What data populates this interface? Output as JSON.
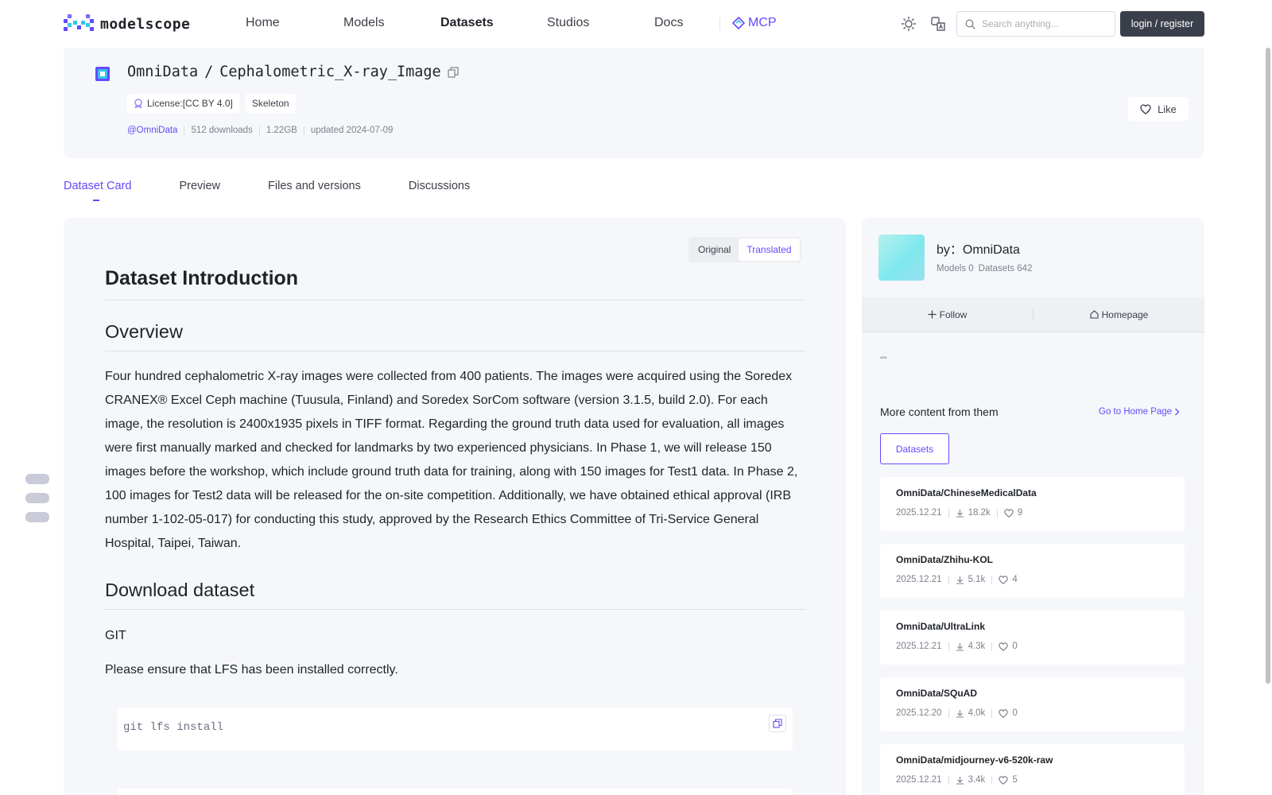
{
  "nav": {
    "logo_text": "modelscope",
    "links": [
      "Home",
      "Models",
      "Datasets",
      "Studios",
      "Docs"
    ],
    "mcp_label": "MCP",
    "search_placeholder": "Search anything...",
    "login_label": "login / register",
    "accent": "#624aff"
  },
  "dataset": {
    "owner": "OmniData",
    "separator": "/",
    "name": "Cephalometric_X-ray_Image",
    "tags": [
      "License:[CC BY 4.0]",
      "Skeleton"
    ],
    "owner_handle": "@OmniData",
    "downloads": "512 downloads",
    "size": "1.22GB",
    "updated": "updated 2024-07-09",
    "like_label": "Like"
  },
  "tabs": [
    "Dataset Card",
    "Preview",
    "Files and versions",
    "Discussions"
  ],
  "content": {
    "toggle_original": "Original",
    "toggle_translated": "Translated",
    "h1": "Dataset Introduction",
    "h2_overview": "Overview",
    "overview_text": "Four hundred cephalometric X-ray images were collected from 400 patients. The images were acquired using the Soredex CRANEX® Excel Ceph machine (Tuusula, Finland) and Soredex SorCom software (version 3.1.5, build 2.0). For each image, the resolution is 2400x1935 pixels in TIFF format. Regarding the ground truth data used for evaluation, all images were first manually marked and checked for landmarks by two experienced physicians. In Phase 1, we will release 150 images before the workshop, which include ground truth data for training, along with 150 images for Test1 data. In Phase 2, 100 images for Test2 data will be released for the on-site competition. Additionally, we have obtained ethical approval (IRB number 1-102-05-017) for conducting this study, approved by the Research Ethics Committee of Tri-Service General Hospital, Taipei, Taiwan.",
    "h2_download": "Download dataset",
    "git_label": "GIT",
    "lfs_note": "Please ensure that LFS has been installed correctly.",
    "code_line": "git lfs install"
  },
  "sidebar": {
    "by_prefix": "by：",
    "author": "OmniData",
    "models_count": "Models 0",
    "datasets_count": "Datasets 642",
    "follow_label": "Follow",
    "homepage_label": "Homepage",
    "quote": "\"\"",
    "more_title": "More content from them",
    "go_home_label": "Go to Home Page",
    "datasets_tab": "Datasets",
    "items": [
      {
        "name": "OmniData/ChineseMedicalData",
        "date": "2025.12.21",
        "downloads": "18.2k",
        "likes": "9"
      },
      {
        "name": "OmniData/Zhihu-KOL",
        "date": "2025.12.21",
        "downloads": "5.1k",
        "likes": "4"
      },
      {
        "name": "OmniData/UltraLink",
        "date": "2025.12.21",
        "downloads": "4.3k",
        "likes": "0"
      },
      {
        "name": "OmniData/SQuAD",
        "date": "2025.12.20",
        "downloads": "4.0k",
        "likes": "0"
      },
      {
        "name": "OmniData/midjourney-v6-520k-raw",
        "date": "2025.12.21",
        "downloads": "3.4k",
        "likes": "5"
      }
    ]
  }
}
